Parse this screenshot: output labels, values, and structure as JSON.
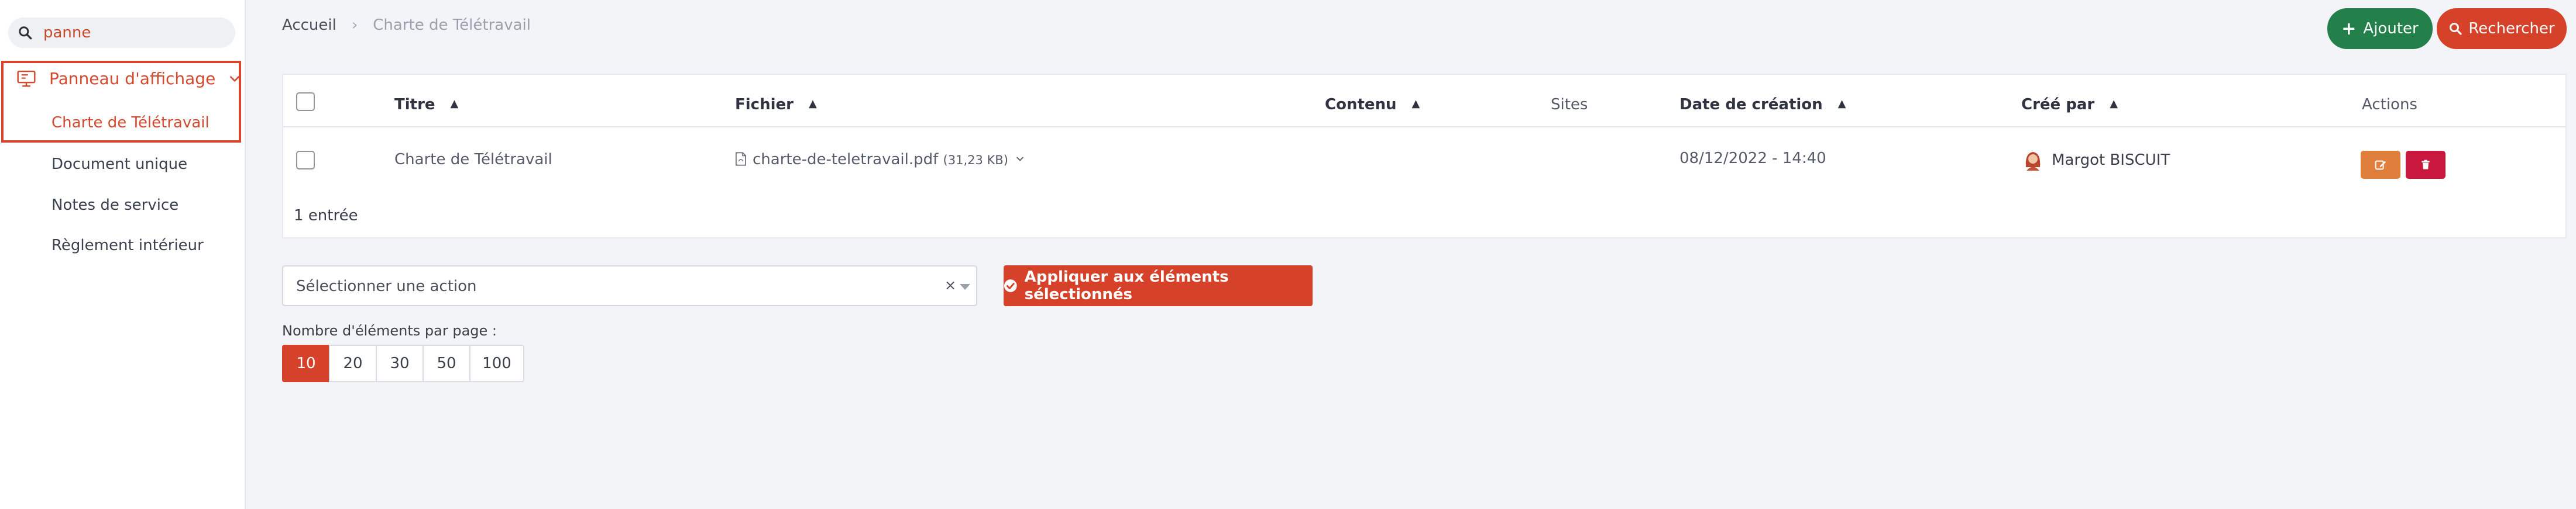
{
  "sidebar": {
    "search": {
      "value": "panne",
      "icon": "search-icon"
    },
    "parent": {
      "label": "Panneau d'affichage",
      "icon": "monitor-icon"
    },
    "items": [
      {
        "label": "Charte de Télétravail",
        "active": true
      },
      {
        "label": "Document unique"
      },
      {
        "label": "Notes de service"
      },
      {
        "label": "Règlement intérieur"
      }
    ]
  },
  "breadcrumb": {
    "home": "Accueil",
    "current": "Charte de Télétravail"
  },
  "toolbar": {
    "add_label": "Ajouter",
    "search_label": "Rechercher"
  },
  "table": {
    "columns": {
      "title": "Titre",
      "file": "Fichier",
      "content": "Contenu",
      "sites": "Sites",
      "created": "Date de création",
      "author": "Créé par",
      "actions": "Actions"
    },
    "rows": [
      {
        "title": "Charte de Télétravail",
        "file_name": "charte-de-teletravail.pdf",
        "file_size": "(31,23 KB)",
        "content": "",
        "sites": "",
        "created": "08/12/2022 - 14:40",
        "author": "Margot BISCUIT"
      }
    ],
    "count": "1 entrée"
  },
  "bulk": {
    "placeholder": "Sélectionner une action",
    "clear": "×",
    "apply_label": "Appliquer aux éléments sélectionnés"
  },
  "pagination": {
    "label": "Nombre d'éléments par page :",
    "options": [
      "10",
      "20",
      "30",
      "50",
      "100"
    ],
    "selected": "10"
  },
  "colors": {
    "accent": "#d6412a",
    "add": "#24804a",
    "edit": "#e07f3b",
    "delete": "#c8183d"
  }
}
